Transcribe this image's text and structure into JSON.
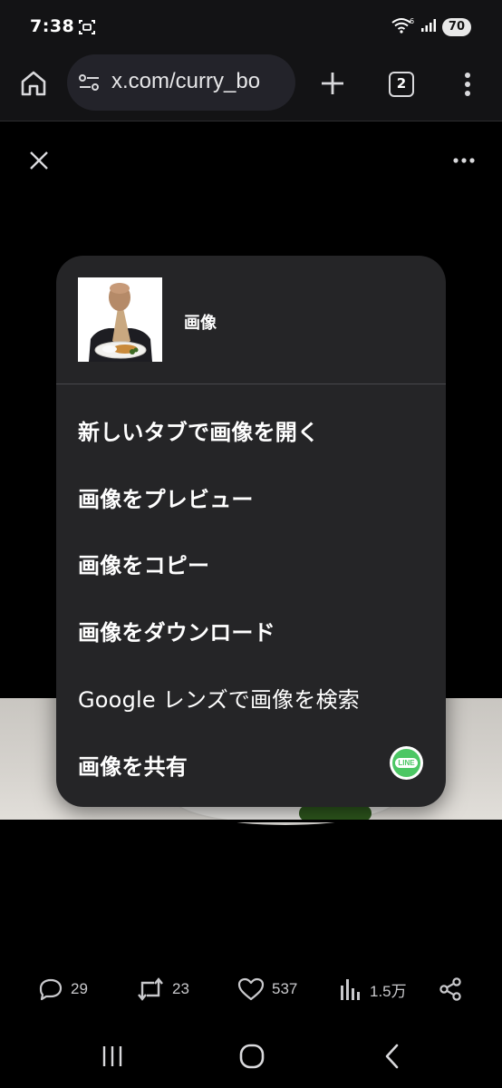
{
  "status_bar": {
    "time": "7:38",
    "network_label": "6",
    "battery": "70"
  },
  "browser": {
    "url": "x.com/curry_bo",
    "tab_count": "2"
  },
  "context_menu": {
    "title": "画像",
    "items": [
      {
        "label": "新しいタブで画像を開く"
      },
      {
        "label": "画像をプレビュー"
      },
      {
        "label": "画像をコピー"
      },
      {
        "label": "画像をダウンロード"
      },
      {
        "label": "Google レンズで画像を検索"
      },
      {
        "label": "画像を共有"
      }
    ],
    "share_app": "LINE"
  },
  "actions": {
    "replies": "29",
    "reposts": "23",
    "likes": "537",
    "views": "1.5万"
  },
  "colors": {
    "menu_bg": "#252527",
    "line_green": "#4cc764",
    "toolbar_bg": "#131315"
  }
}
